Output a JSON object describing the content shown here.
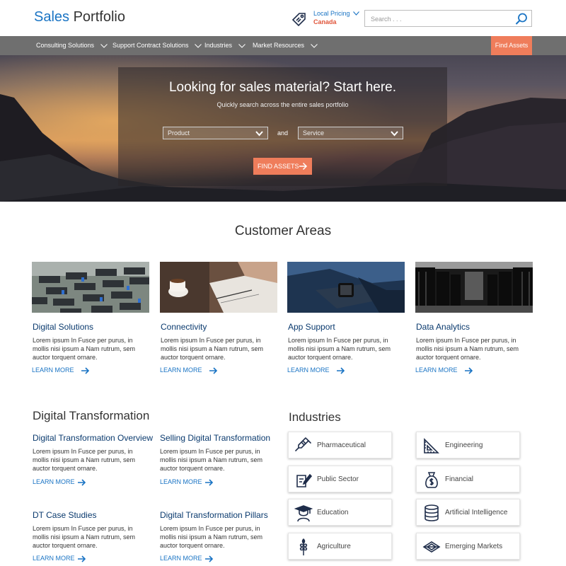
{
  "header": {
    "brand_part1": "Sales",
    "brand_part2": " Portfolio",
    "local_pricing": "Local Pricing",
    "country": "Canada",
    "search_placeholder": "Search . . ."
  },
  "nav": {
    "items": [
      {
        "label": "Consulting Solutions"
      },
      {
        "label": "Support Contract Solutions"
      },
      {
        "label": "Industries"
      },
      {
        "label": "Market Resources"
      }
    ],
    "find_assets": "Find Assets"
  },
  "hero": {
    "title": "Looking for sales material? Start here.",
    "subtitle": "Quickly search across the entire sales portfolio",
    "product_select": "Product",
    "and_label": "and",
    "service_select": "Service",
    "button": "FIND ASSETS"
  },
  "customer_areas": {
    "title": "Customer Areas",
    "cards": [
      {
        "title": "Digital Solutions",
        "body": "Lorem ipsum In Fusce per purus, in mollis nisi ipsum a Nam rutrum, sem auctor torquent ornare.",
        "link": "LEARN MORE"
      },
      {
        "title": "Connectivity",
        "body": "Lorem ipsum In Fusce per purus, in mollis nisi ipsum a Nam rutrum, sem auctor torquent ornare.",
        "link": "LEARN MORE"
      },
      {
        "title": "App Support",
        "body": "Lorem ipsum In Fusce per purus, in mollis nisi ipsum a Nam rutrum, sem auctor torquent ornare.",
        "link": "LEARN MORE"
      },
      {
        "title": "Data Analytics",
        "body": "Lorem ipsum In Fusce per purus, in mollis nisi ipsum a Nam rutrum, sem auctor torquent ornare.",
        "link": "LEARN MORE"
      }
    ]
  },
  "digital_transformation": {
    "title": "Digital Transformation",
    "items": [
      {
        "title": "Digital Transformation Overview",
        "body": "Lorem ipsum In Fusce per purus, in mollis nisi ipsum a Nam rutrum, sem auctor torquent ornare.",
        "link": "LEARN MORE"
      },
      {
        "title": "Selling Digital Transformation",
        "body": "Lorem ipsum In Fusce per purus, in mollis nisi ipsum a Nam rutrum, sem auctor torquent ornare.",
        "link": "LEARN MORE"
      },
      {
        "title": "DT Case Studies",
        "body": "Lorem ipsum In Fusce per purus, in mollis nisi ipsum a Nam rutrum, sem auctor torquent ornare.",
        "link": "LEARN MORE"
      },
      {
        "title": "Digital Transformation Pillars",
        "body": "Lorem ipsum In Fusce per purus, in mollis nisi ipsum a Nam rutrum, sem auctor torquent ornare.",
        "link": "LEARN MORE"
      }
    ]
  },
  "industries": {
    "title": "Industries",
    "items": [
      {
        "label": "Pharmaceutical",
        "icon": "syringe-icon"
      },
      {
        "label": "Engineering",
        "icon": "set-square-icon"
      },
      {
        "label": "Public Sector",
        "icon": "document-pen-icon"
      },
      {
        "label": "Financial",
        "icon": "money-bag-icon"
      },
      {
        "label": "Education",
        "icon": "graduate-icon"
      },
      {
        "label": "Artificial Intelligence",
        "icon": "database-icon"
      },
      {
        "label": "Agriculture",
        "icon": "wheat-icon"
      },
      {
        "label": "Emerging Markets",
        "icon": "diamond-icon"
      }
    ]
  },
  "colors": {
    "brand_blue": "#1a74c4",
    "accent_orange": "#ef7d5b",
    "nav_gray": "#6f6f6f",
    "heading_navy": "#0a3a6e",
    "country_red": "#e0563b"
  }
}
